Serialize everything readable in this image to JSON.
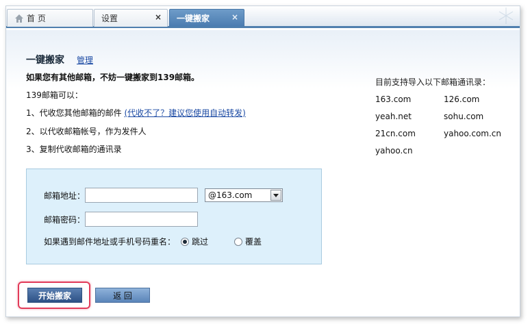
{
  "tabs": [
    {
      "label": "首 页",
      "icon": "home-icon"
    },
    {
      "label": "设置",
      "close": "×"
    },
    {
      "label": "一键搬家",
      "close": "×",
      "active": true
    }
  ],
  "header": {
    "title": "一键搬家",
    "manage_link": "管理"
  },
  "intro": "如果您有其他邮箱，不妨一键搬家到139邮箱。",
  "can_do": "139邮箱可以：",
  "features": {
    "f1_text": "1、代收您其他邮箱的邮件 ",
    "f1_link": "(代收不了？建议您使用自动转发)",
    "f2": "2、以代收邮箱帐号，作为发件人",
    "f3": "3、复制代收邮箱的通讯录"
  },
  "support": {
    "title": "目前支持导入以下邮箱通讯录：",
    "domains": [
      "163.com",
      "126.com",
      "yeah.net",
      "sohu.com",
      "21cn.com",
      "yahoo.com.cn",
      "yahoo.cn"
    ]
  },
  "form": {
    "email_label": "邮箱地址：",
    "email_value": "",
    "domain_selected": "@163.com",
    "password_label": "邮箱密码：",
    "password_value": "",
    "conflict_label": "如果遇到邮件地址或手机号码重名：",
    "option_skip": "跳过",
    "option_overwrite": "覆盖",
    "selected_option": "跳过"
  },
  "buttons": {
    "start": "开始搬家",
    "back": "返 回"
  },
  "colors": {
    "accent": "#4a7bb0",
    "link": "#1a49a3",
    "form_bg": "#ddf0fb",
    "highlight": "#e23c5a"
  }
}
